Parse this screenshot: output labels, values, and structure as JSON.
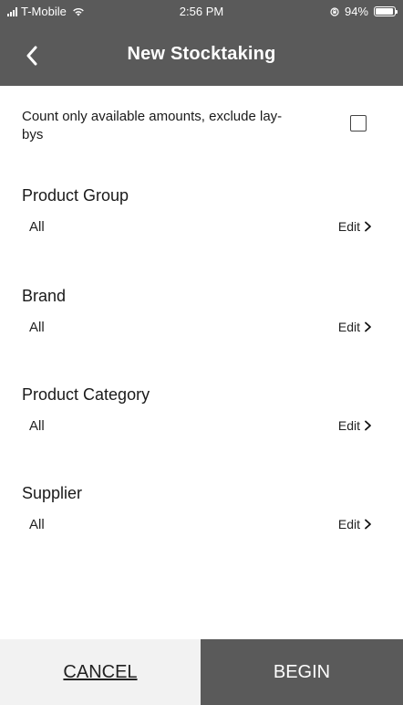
{
  "status_bar": {
    "carrier": "T-Mobile",
    "time": "2:56 PM",
    "battery_percent": "94%",
    "battery_level": 0.94
  },
  "nav": {
    "title": "New Stocktaking",
    "back_icon": "chevron-left-icon"
  },
  "option": {
    "label": "Count only available amounts, exclude lay-bys",
    "checked": false
  },
  "filters": [
    {
      "title": "Product Group",
      "value": "All",
      "edit_label": "Edit"
    },
    {
      "title": "Brand",
      "value": "All",
      "edit_label": "Edit"
    },
    {
      "title": "Product Category",
      "value": "All",
      "edit_label": "Edit"
    },
    {
      "title": "Supplier",
      "value": "All",
      "edit_label": "Edit"
    }
  ],
  "footer": {
    "cancel_label": "CANCEL",
    "begin_label": "BEGIN"
  },
  "colors": {
    "header_bg": "#5a5a5a",
    "cancel_bg": "#f2f2f2",
    "begin_bg": "#5a5a5a"
  }
}
